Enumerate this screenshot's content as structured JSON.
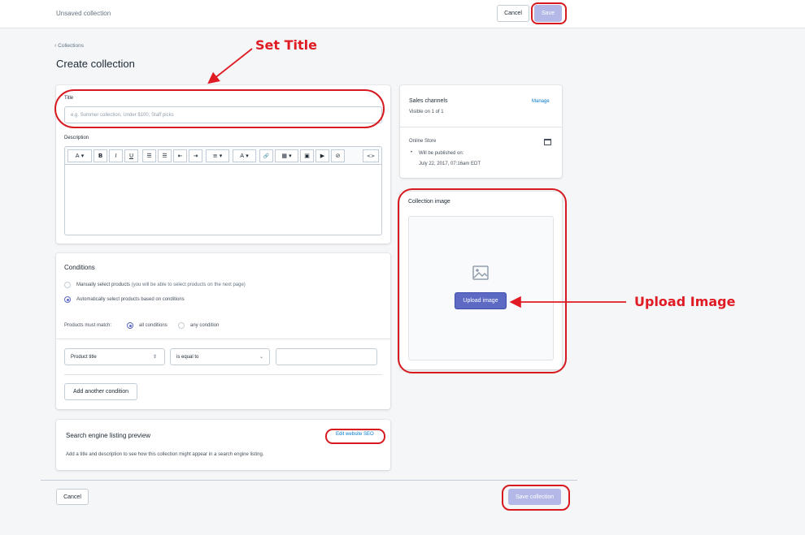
{
  "topbar": {
    "title": "Unsaved collection",
    "cancel_label": "Cancel",
    "save_label": "Save"
  },
  "breadcrumb": {
    "label": "Collections"
  },
  "page": {
    "title": "Create collection"
  },
  "title_field": {
    "label": "Title",
    "placeholder": "e.g. Summer collection, Under $100, Staff picks"
  },
  "description": {
    "label": "Description",
    "toolbar": [
      "A ▾",
      "B",
      "I",
      "U",
      "☰",
      "☰",
      "⇤",
      "⇥",
      "≡ ▾",
      "A ▾",
      "🔗",
      "▦ ▾",
      "▣",
      "▶",
      "⊘",
      "<>"
    ]
  },
  "conditions": {
    "title": "Conditions",
    "manual_option": "Manually select products",
    "manual_hint": "(you will be able to select products on the next page)",
    "auto_option": "Automatically select products based on conditions",
    "must_match_label": "Products must match:",
    "all_label": "all conditions",
    "any_label": "any condition",
    "field_select": "Product title",
    "operator_select": "is equal to",
    "value": "",
    "add_label": "Add another condition"
  },
  "seo": {
    "title": "Search engine listing preview",
    "edit_link": "Edit website SEO",
    "description": "Add a title and description to see how this collection might appear in a search engine listing."
  },
  "sales_channels": {
    "title": "Sales channels",
    "manage_link": "Manage",
    "visibility": "Visible on 1 of 1",
    "store_name": "Online Store",
    "publish_label": "Will be published on:",
    "publish_date": "July 22, 2017, 07:16am EDT"
  },
  "collection_image": {
    "title": "Collection image",
    "upload_label": "Upload image"
  },
  "footer": {
    "cancel_label": "Cancel",
    "save_label": "Save collection"
  },
  "annotations": {
    "set_title": "Set Title",
    "upload_image": "Upload Image"
  },
  "colors": {
    "annotation": "#e01b24",
    "primary_disabled": "#b3b8e6",
    "indigo": "#5c6ac4",
    "link": "#007ace"
  }
}
